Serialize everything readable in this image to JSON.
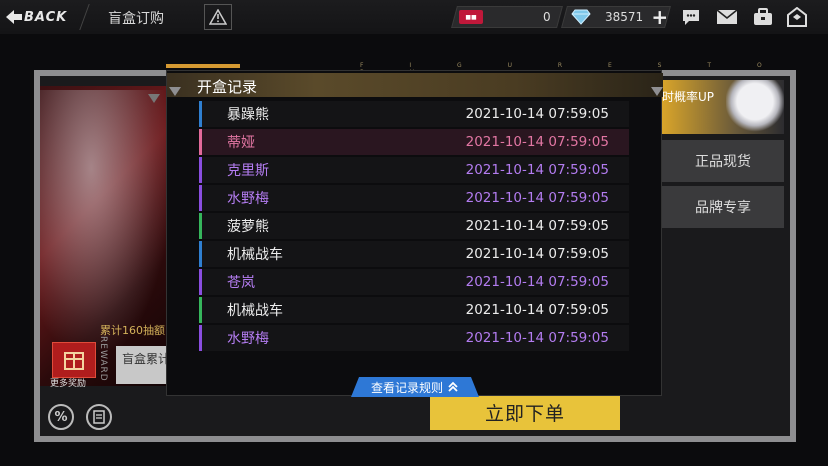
{
  "topbar": {
    "back_label": "BACK",
    "title": "盲盒订购",
    "tickets_icon": "ticket-icon",
    "tickets": "0",
    "gems_icon": "diamond-icon",
    "gems": "38571"
  },
  "background": {
    "deco_letters": "F I G U R E S T O R Y",
    "banner_text": "累计160抽额",
    "reward_label": "更多奖励",
    "reward_vertical": "REWARD",
    "left_button": "盲盒累计",
    "right_banner": "时概率UP",
    "tab_authentic": "正品现货",
    "tab_brand": "品牌专享",
    "buy_button": "立即下单"
  },
  "modal": {
    "title": "开盒记录",
    "rules_button": "查看记录规则",
    "records": [
      {
        "name": "暴躁熊",
        "time": "2021-10-14 07:59:05",
        "rarity": "blue"
      },
      {
        "name": "蒂娅",
        "time": "2021-10-14 07:59:05",
        "rarity": "pink"
      },
      {
        "name": "克里斯",
        "time": "2021-10-14 07:59:05",
        "rarity": "purple"
      },
      {
        "name": "水野梅",
        "time": "2021-10-14 07:59:05",
        "rarity": "purple"
      },
      {
        "name": "菠萝熊",
        "time": "2021-10-14 07:59:05",
        "rarity": "green"
      },
      {
        "name": "机械战车",
        "time": "2021-10-14 07:59:05",
        "rarity": "blue"
      },
      {
        "name": "苍岚",
        "time": "2021-10-14 07:59:05",
        "rarity": "purple"
      },
      {
        "name": "机械战车",
        "time": "2021-10-14 07:59:05",
        "rarity": "green"
      },
      {
        "name": "水野梅",
        "time": "2021-10-14 07:59:05",
        "rarity": "purple"
      }
    ]
  },
  "colors": {
    "blue": "#2f7fd0",
    "pink": "#e36a9a",
    "purple": "#8a4ee0",
    "green": "#36b65c",
    "gold": "#e8c33a",
    "rules_blue": "#2e78d6"
  }
}
